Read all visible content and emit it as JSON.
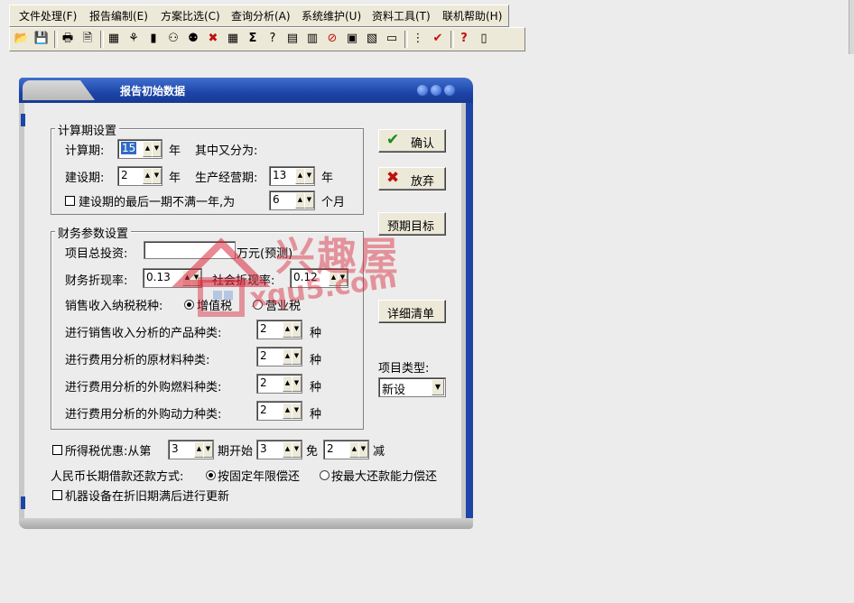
{
  "menu": [
    "文件处理(F)",
    "报告编制(E)",
    "方案比选(C)",
    "查询分析(A)",
    "系统维护(U)",
    "资料工具(T)",
    "联机帮助(H)"
  ],
  "toolbar_icons": [
    "open-folder-icon",
    "save-icon",
    "print-icon",
    "page-icon",
    "chart-icon",
    "tree-icon",
    "calculator-icon",
    "users-icon",
    "people-icon",
    "delete-icon",
    "table-icon",
    "sum-icon",
    "formula-icon",
    "calc-icon",
    "bar-chart-icon",
    "stop-icon",
    "report-icon",
    "notes-icon",
    "window-icon",
    "list-icon",
    "check-icon",
    "help-icon",
    "exit-icon"
  ],
  "toolbar_glyphs": [
    "📂",
    "💾",
    "🖶",
    "🗎",
    "▦",
    "⚘",
    "▮",
    "⚇",
    "⚉",
    "✖",
    "▦",
    "Σ",
    "?",
    "▤",
    "▥",
    "⊘",
    "▣",
    "▧",
    "▭",
    "⋮",
    "✔",
    "?",
    "▯"
  ],
  "dialog": {
    "title": "报告初始数据",
    "calc_group": {
      "legend": "计算期设置",
      "calc_period_label": "计算期:",
      "calc_period_value": "15",
      "year": "年",
      "split_label": "其中又分为:",
      "construction_label": "建设期:",
      "construction_value": "2",
      "operation_label": "生产经营期:",
      "operation_value": "13",
      "partial_label": "建设期的最后一期不满一年,为",
      "partial_value": "6",
      "months": "个月"
    },
    "fin_group": {
      "legend": "财务参数设置",
      "investment_label": "项目总投资:",
      "investment_value": "",
      "investment_unit": "万元(预测)",
      "fin_rate_label": "财务折现率:",
      "fin_rate_value": "0.13",
      "soc_rate_label": "社会折现率:",
      "soc_rate_value": "0.12",
      "tax_label": "销售收入纳税税种:",
      "tax_vat": "增值税",
      "tax_business": "营业税",
      "rows": [
        {
          "label": "进行销售收入分析的产品种类:",
          "value": "2",
          "unit": "种"
        },
        {
          "label": "进行费用分析的原材料种类:",
          "value": "2",
          "unit": "种"
        },
        {
          "label": "进行费用分析的外购燃料种类:",
          "value": "2",
          "unit": "种"
        },
        {
          "label": "进行费用分析的外购动力种类:",
          "value": "2",
          "unit": "种"
        }
      ]
    },
    "tax_pref": {
      "label": "所得税优惠:从第",
      "start_value": "3",
      "start_suffix": "期开始",
      "exempt_value": "3",
      "exempt_suffix": "免",
      "reduce_value": "2",
      "reduce_suffix": "减"
    },
    "loan": {
      "label": "人民币长期借款还款方式:",
      "option_fixed": "按固定年限偿还",
      "option_max": "按最大还款能力偿还"
    },
    "equipment_label": "机器设备在折旧期满后进行更新",
    "buttons": {
      "confirm": "确认",
      "cancel": "放弃",
      "target": "预期目标",
      "detail": "详细清单"
    },
    "project_type_label": "项目类型:",
    "project_type_value": "新设"
  },
  "watermark": {
    "text1": "兴趣屋",
    "text2": "xqu5.com"
  },
  "colors": {
    "accent": "#1d45a8",
    "watermark": "#d9263a",
    "confirm_icon": "#1a8a1a",
    "cancel_icon": "#c01010"
  }
}
